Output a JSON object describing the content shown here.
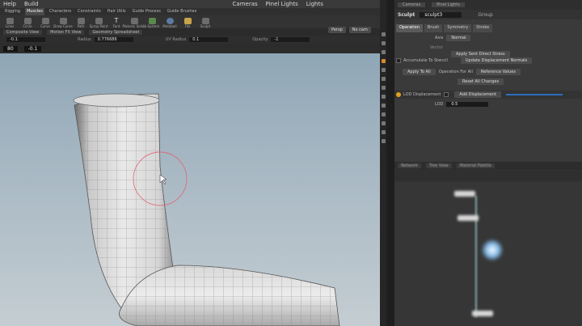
{
  "menubar": {
    "items": [
      "Help",
      "Build",
      "Cameras",
      "Pinel Lights",
      "Lights"
    ]
  },
  "shelf_tabs": [
    "Rigging",
    "Muscles",
    "Characters",
    "Constraints",
    "Hair Utils",
    "Guide Process",
    "Guide Brushes"
  ],
  "tools": [
    "Lines",
    "Circle",
    "Curve",
    "Draw Curve",
    "Path",
    "Spray Paint",
    "Font",
    "Platonic Solids",
    "L-System",
    "Metaball",
    "File",
    "Sculpt"
  ],
  "pane_tabs": [
    "Composite View",
    "Motion FX View",
    "Geometry Spreadsheet"
  ],
  "param_row": {
    "value_left": "-0.1",
    "radius_label": "Radius",
    "radius_value": "0.776686",
    "uv_label": "UV Radius",
    "uv_value": "0.1",
    "opacity_label": "Opacity",
    "opacity_value": "-1"
  },
  "viewport_header": {
    "field1": "80",
    "field2": "-0.1"
  },
  "view_buttons": [
    "Persp",
    "No cam"
  ],
  "right_panel": {
    "top_tabs": [
      "Cameras",
      "Pinel Lights"
    ],
    "node_kind": "Sculpt",
    "node_name": "sculpt3",
    "group_label": "Group",
    "tabs": [
      "Operation",
      "Brush",
      "Symmetry",
      "Stroke"
    ],
    "axis_label": "Axis",
    "axis_value": "Normal",
    "vector_label": "Vector",
    "apply_button": "Apply Sent Direct Stress",
    "accumulate_label": "Accumulate To Stencil",
    "update_button": "Update Displacement Normals",
    "apply_to_all": "Apply To All",
    "operation_for_all": "Operation For All",
    "reference_button": "Reference Values",
    "reset_button": "Reset All Changes",
    "lod_label": "LOD Displacement",
    "lod_value": "Add Displacement",
    "lod_field_label": "LOD",
    "lod_field_value": "0.5"
  },
  "network_tabs": [
    "Network",
    "Tree View",
    "Material Palette"
  ]
}
